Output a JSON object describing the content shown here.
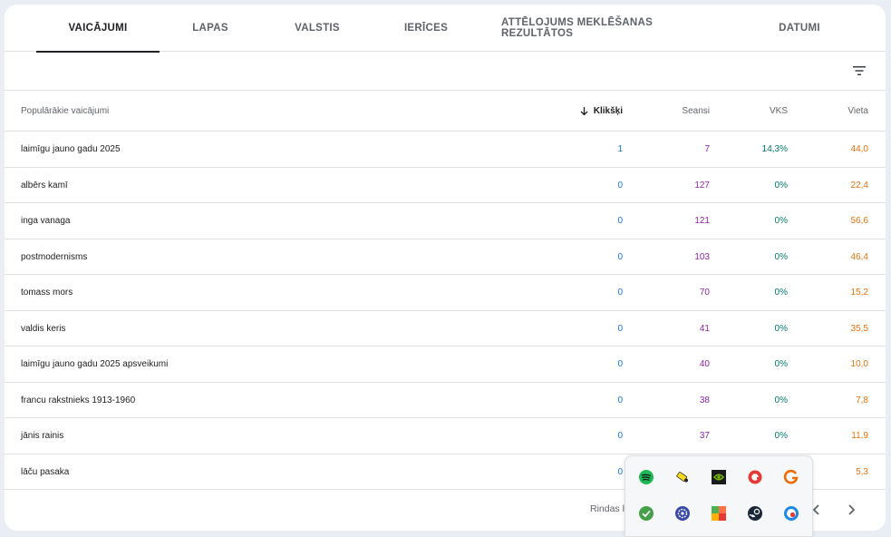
{
  "tabs": [
    {
      "label": "VAICĀJUMI",
      "active": true
    },
    {
      "label": "LAPAS",
      "active": false
    },
    {
      "label": "VALSTIS",
      "active": false
    },
    {
      "label": "IERĪCES",
      "active": false
    },
    {
      "label": "ATTĒLOJUMS MEKLĒŠANAS REZULTĀTOS",
      "active": false
    },
    {
      "label": "DATUMI",
      "active": false
    }
  ],
  "table": {
    "headers": {
      "query": "Populārākie vaicājumi",
      "clicks": "Klikšķi",
      "impressions": "Seansi",
      "ctr": "VKS",
      "position": "Vieta"
    },
    "rows": [
      {
        "query": "laimīgu jauno gadu 2025",
        "clicks": "1",
        "impressions": "7",
        "ctr": "14,3%",
        "position": "44,0"
      },
      {
        "query": "albērs kamī",
        "clicks": "0",
        "impressions": "127",
        "ctr": "0%",
        "position": "22,4"
      },
      {
        "query": "inga vanaga",
        "clicks": "0",
        "impressions": "121",
        "ctr": "0%",
        "position": "56,6"
      },
      {
        "query": "postmodernisms",
        "clicks": "0",
        "impressions": "103",
        "ctr": "0%",
        "position": "46,4"
      },
      {
        "query": "tomass mors",
        "clicks": "0",
        "impressions": "70",
        "ctr": "0%",
        "position": "15,2"
      },
      {
        "query": "valdis keris",
        "clicks": "0",
        "impressions": "41",
        "ctr": "0%",
        "position": "35,5"
      },
      {
        "query": "laimīgu jauno gadu 2025 apsveikumi",
        "clicks": "0",
        "impressions": "40",
        "ctr": "0%",
        "position": "10,0"
      },
      {
        "query": "francu rakstnieks 1913-1960",
        "clicks": "0",
        "impressions": "38",
        "ctr": "0%",
        "position": "7,8"
      },
      {
        "query": "jānis rainis",
        "clicks": "0",
        "impressions": "37",
        "ctr": "0%",
        "position": "11,9"
      },
      {
        "query": "lāču pasaka",
        "clicks": "0",
        "impressions": "",
        "ctr": "",
        "position": "5,3"
      }
    ]
  },
  "footer": {
    "rows_per_page_label": "Rindas l"
  },
  "colors": {
    "clicks": "#1a73e8",
    "impressions": "#8e24aa",
    "ctr": "#00796b",
    "position": "#e8710a"
  },
  "tray_icons": [
    "spotify-icon",
    "usb-key-icon",
    "nvidia-icon",
    "red-circle-app-icon",
    "grammarly-icon",
    "green-check-icon",
    "blue-gear-app-icon",
    "avast-icon",
    "steam-icon",
    "blue-network-icon"
  ]
}
